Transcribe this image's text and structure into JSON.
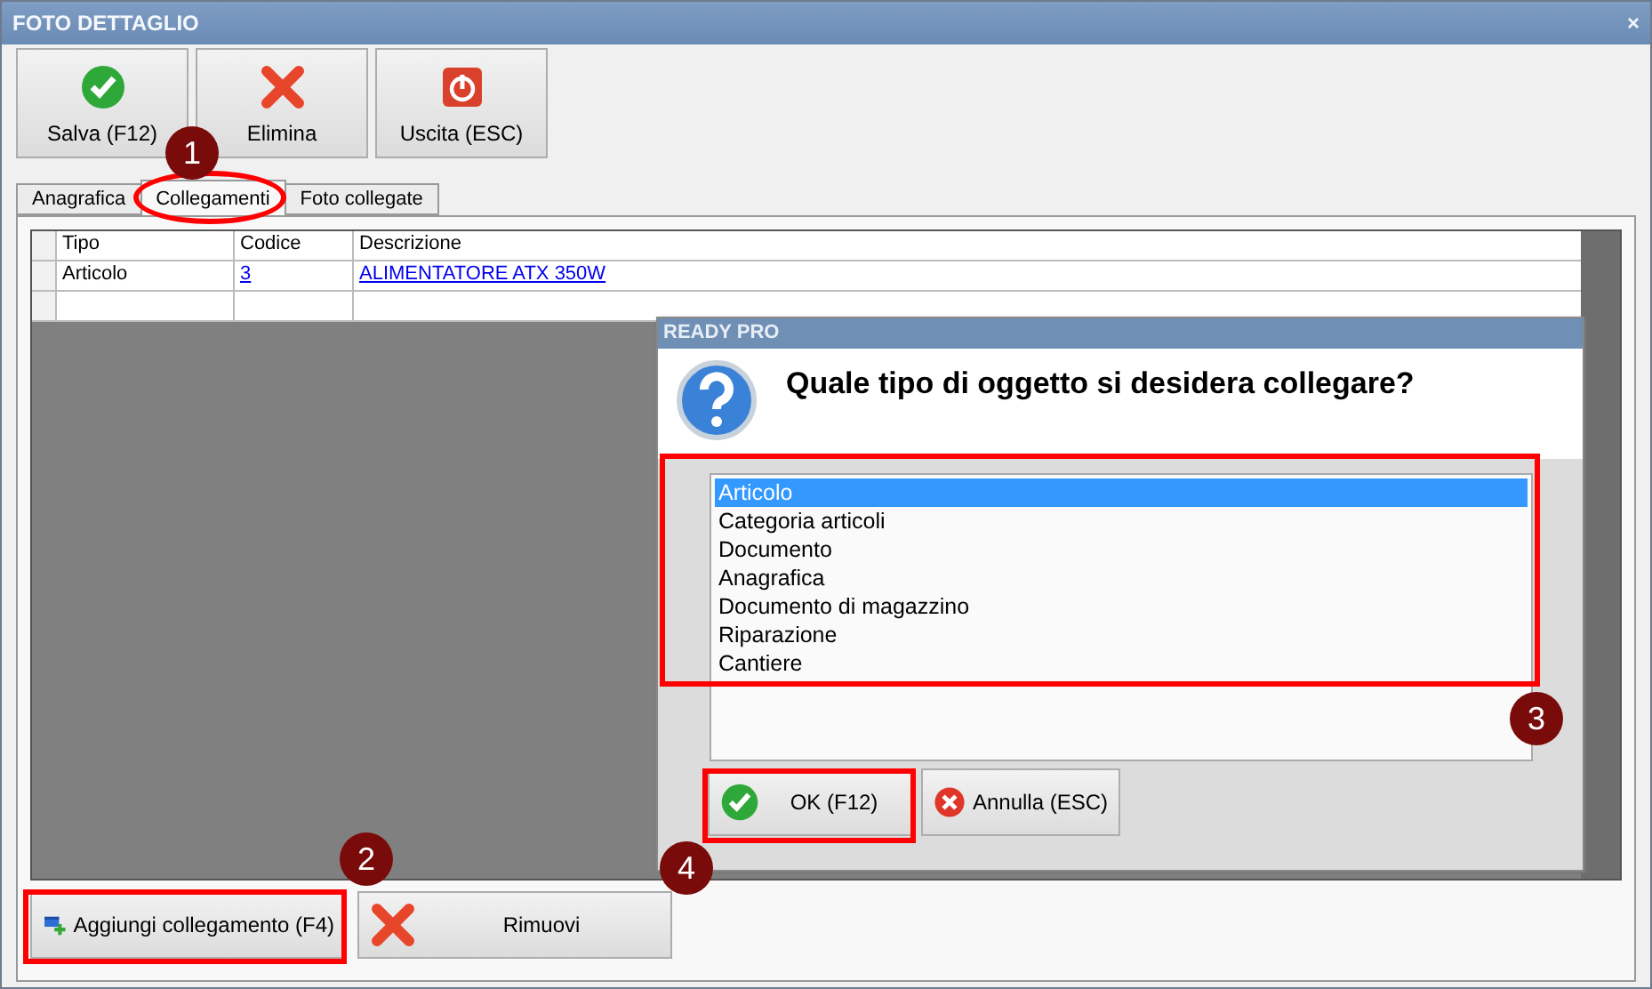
{
  "window": {
    "title": "FOTO DETTAGLIO",
    "close": "×"
  },
  "toolbar": [
    {
      "label": "Salva (F12)",
      "kind": "check"
    },
    {
      "label": "Elimina",
      "kind": "cross"
    },
    {
      "label": "Uscita (ESC)",
      "kind": "power"
    }
  ],
  "tabs": [
    {
      "label": "Anagrafica",
      "selected": false
    },
    {
      "label": "Collegamenti",
      "selected": true
    },
    {
      "label": "Foto collegate",
      "selected": false
    }
  ],
  "table": {
    "columns": [
      "Tipo",
      "Codice",
      "Descrizione"
    ],
    "rows": [
      {
        "tipo": "Articolo",
        "codice": "3",
        "descrizione": "ALIMENTATORE ATX 350W"
      }
    ]
  },
  "dialog": {
    "title": "READY PRO",
    "question": "Quale tipo di oggetto si desidera collegare?",
    "items": [
      {
        "label": "Articolo",
        "selected": true
      },
      {
        "label": "Categoria articoli",
        "selected": false
      },
      {
        "label": "Documento",
        "selected": false
      },
      {
        "label": "Anagrafica",
        "selected": false
      },
      {
        "label": "Documento di magazzino",
        "selected": false
      },
      {
        "label": "Riparazione",
        "selected": false
      },
      {
        "label": "Cantiere",
        "selected": false
      }
    ],
    "buttons": [
      {
        "label": "OK (F12)",
        "kind": "check"
      },
      {
        "label": "Annulla (ESC)",
        "kind": "cancel"
      }
    ]
  },
  "bottom_buttons": [
    {
      "label": "Aggiungi collegamento (F4)",
      "kind": "add"
    },
    {
      "label": "Rimuovi",
      "kind": "cross"
    }
  ],
  "annotations": [
    "1",
    "2",
    "3",
    "4"
  ]
}
